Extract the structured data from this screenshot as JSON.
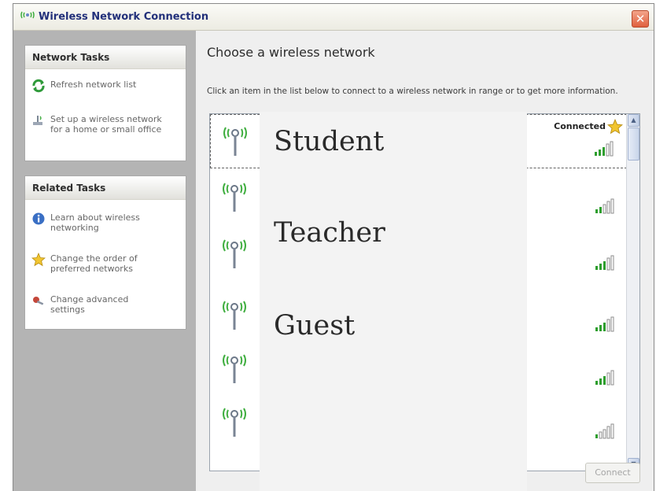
{
  "window": {
    "title": "Wireless Network Connection",
    "close_symbol": "✕"
  },
  "network_tasks": {
    "heading": "Network Tasks",
    "items": [
      {
        "label": "Refresh network list",
        "icon": "refresh-icon"
      },
      {
        "label": "Set up a wireless network\nfor a home or small office",
        "icon": "setup-network-icon"
      }
    ]
  },
  "related_tasks": {
    "heading": "Related Tasks",
    "items": [
      {
        "label": "Learn about wireless\nnetworking",
        "icon": "info-icon"
      },
      {
        "label": "Change the order of\npreferred networks",
        "icon": "star-icon"
      },
      {
        "label": "Change advanced\nsettings",
        "icon": "advanced-settings-icon"
      }
    ]
  },
  "main": {
    "title": "Choose a wireless network",
    "description": "Click an item in the list below to connect to a wireless network in range or to get more information.",
    "connected_label": "Connected",
    "connect_button": "Connect"
  },
  "overlay": {
    "labels": [
      "Student",
      "Teacher",
      "Guest"
    ]
  },
  "colors": {
    "title_text": "#22307a",
    "left_pane": "#b4b4b4",
    "antenna_green": "#3fae3f",
    "signal_green": "#2e9e2e"
  }
}
